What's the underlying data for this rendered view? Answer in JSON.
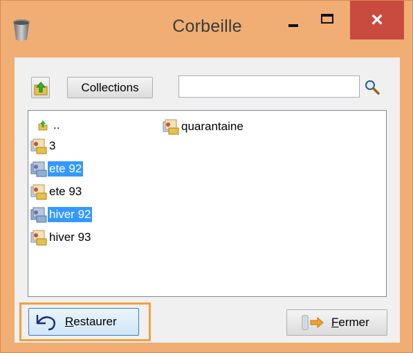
{
  "window": {
    "title": "Corbeille",
    "app_icon": "trash-bin-icon",
    "controls": {
      "minimize": "minimize-icon",
      "maximize": "maximize-icon",
      "close": "×"
    }
  },
  "toolbar": {
    "up_icon": "folder-up-icon",
    "collections_label": "Collections",
    "search_value": "",
    "search_placeholder": "",
    "search_icon": "magnifier-icon"
  },
  "list": {
    "items": [
      {
        "label": "..",
        "icon": "parent-folder-icon",
        "selected": false
      },
      {
        "label": "3",
        "icon": "album-icon",
        "selected": false
      },
      {
        "label": "ete 92",
        "icon": "album-icon",
        "selected": true
      },
      {
        "label": "ete 93",
        "icon": "album-icon",
        "selected": false
      },
      {
        "label": "hiver 92",
        "icon": "album-icon",
        "selected": true
      },
      {
        "label": "hiver 93",
        "icon": "album-icon",
        "selected": false
      },
      {
        "label": "quarantaine",
        "icon": "album-icon",
        "selected": false
      }
    ]
  },
  "buttons": {
    "restore": {
      "mnemonic": "R",
      "rest": "estaurer",
      "icon": "undo-arrow-icon"
    },
    "close": {
      "mnemonic": "F",
      "rest": "ermer",
      "icon": "exit-door-icon"
    }
  },
  "colors": {
    "accent_frame": "#f0ad74",
    "selection": "#3399ff",
    "close_button": "#c94a3e",
    "highlight_frame": "#f0a040"
  }
}
